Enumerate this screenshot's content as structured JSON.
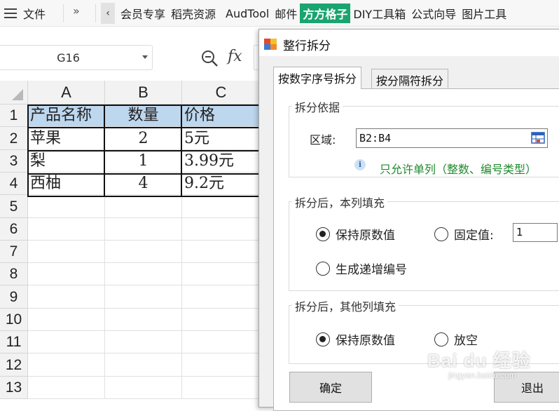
{
  "menubar": {
    "file_label": "文件",
    "more_label": "»",
    "scroll_left": "‹",
    "tabs": [
      "会员专享",
      "稻壳资源",
      "AudTool",
      "邮件",
      "方方格子",
      "DIY工具箱",
      "公式向导",
      "图片工具"
    ],
    "highlight_color": "#1aa46f"
  },
  "formula_bar": {
    "cell_ref": "G16",
    "fx_label": "fx"
  },
  "sheet": {
    "columns": [
      "A",
      "B",
      "C"
    ],
    "rows": [
      "1",
      "2",
      "3",
      "4",
      "5",
      "6",
      "7",
      "8",
      "9",
      "10",
      "11",
      "12",
      "13"
    ],
    "header_fill": "#bdd7ee",
    "data": [
      [
        "产品名称",
        "数量",
        "价格"
      ],
      [
        "苹果",
        "2",
        "5元"
      ],
      [
        "梨",
        "1",
        "3.99元"
      ],
      [
        "西柚",
        "4",
        "9.2元"
      ]
    ]
  },
  "dialog": {
    "title": "整行拆分",
    "tabs": [
      "按数字序号拆分",
      "按分隔符拆分"
    ],
    "group1": {
      "legend": "拆分依据",
      "range_label": "区域:",
      "range_value": "B2:B4",
      "hint": "只允许单列（整数、编号类型）",
      "hint_color": "#1f8a2c"
    },
    "group2": {
      "legend": "拆分后，本列填充",
      "opt_keep": "保持原数值",
      "opt_fixed": "固定值:",
      "fixed_value": "1",
      "opt_increment": "生成递增编号"
    },
    "group3": {
      "legend": "拆分后，其他列填充",
      "opt_keep": "保持原数值",
      "opt_blank": "放空"
    },
    "ok_label": "确定",
    "exit_label": "退出"
  },
  "watermark": {
    "text": "Bai du 经验",
    "sub": "jingyan.baidu.com"
  }
}
